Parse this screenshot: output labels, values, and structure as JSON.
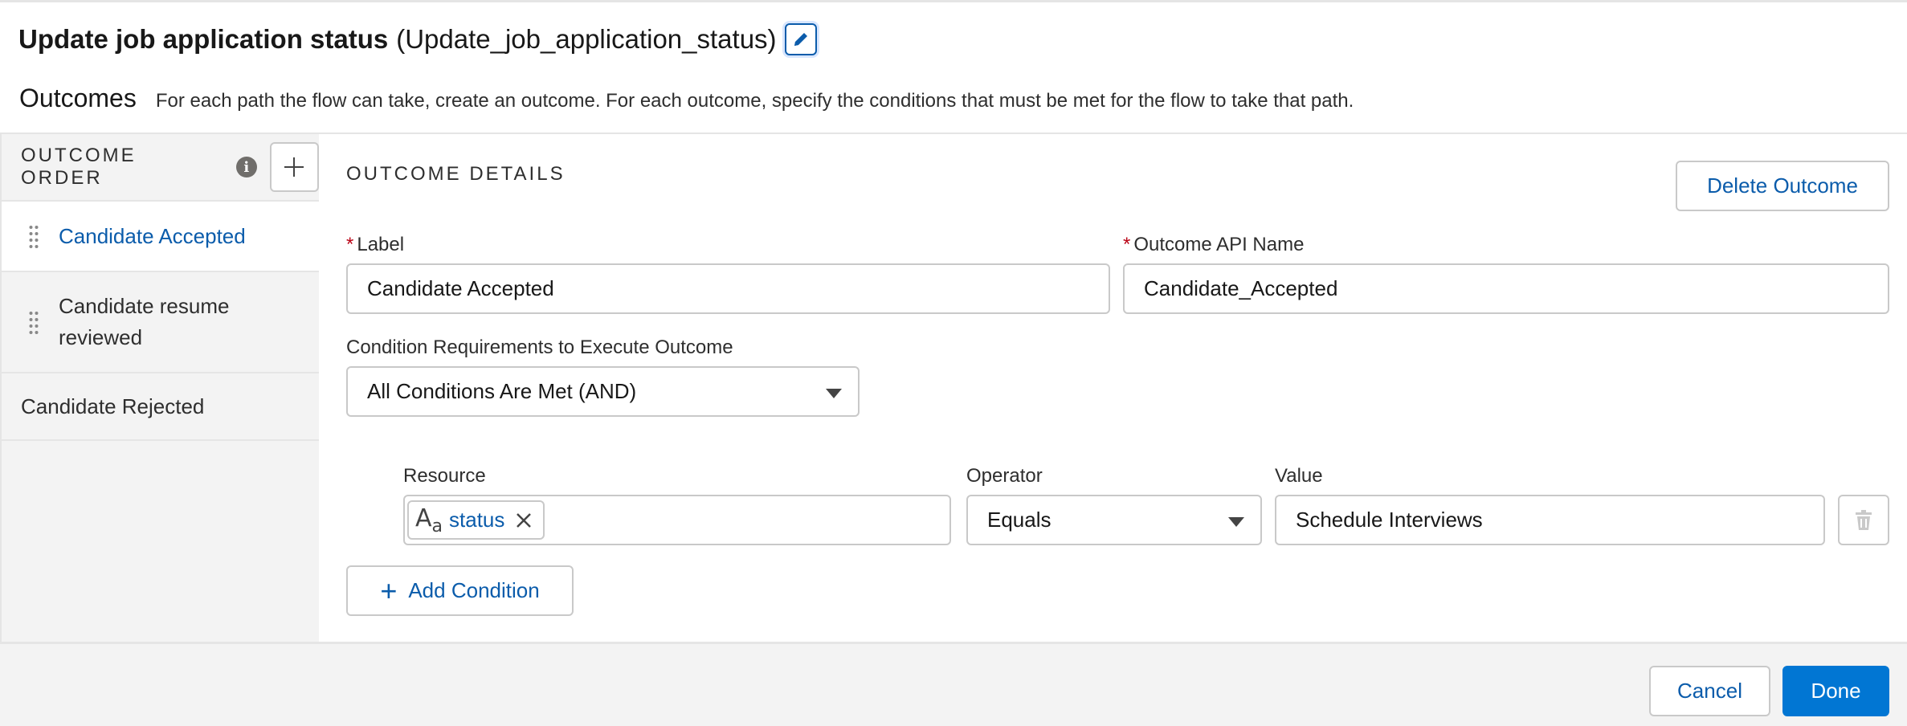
{
  "header": {
    "title": "Update job application status",
    "api_name": "(Update_job_application_status)",
    "edit_icon": "pencil-icon"
  },
  "outcomes_section": {
    "heading": "Outcomes",
    "description": "For each path the flow can take, create an outcome. For each outcome, specify the conditions that must be met for the flow to take that path."
  },
  "sidebar": {
    "header_label": "OUTCOME ORDER",
    "info_icon": "info-icon",
    "info_glyph": "i",
    "add_icon": "plus-icon",
    "items": [
      {
        "label": "Candidate Accepted",
        "active": true
      },
      {
        "label": "Candidate resume reviewed",
        "active": false
      },
      {
        "label": "Candidate Rejected",
        "active": false
      }
    ]
  },
  "details": {
    "heading": "OUTCOME DETAILS",
    "delete_label": "Delete Outcome",
    "required_mark": "*",
    "label_field": {
      "label": "Label",
      "value": "Candidate Accepted"
    },
    "api_field": {
      "label": "Outcome API Name",
      "value": "Candidate_Accepted"
    },
    "condition_req": {
      "label": "Condition Requirements to Execute Outcome",
      "value": "All Conditions Are Met (AND)"
    },
    "condition": {
      "resource_label": "Resource",
      "resource_icon": "text-type-icon",
      "resource_glyph_a": "A",
      "resource_glyph_sub": "a",
      "resource_value": "status",
      "operator_label": "Operator",
      "operator_value": "Equals",
      "value_label": "Value",
      "value_value": "Schedule Interviews"
    },
    "add_condition_label": "Add Condition",
    "add_condition_plus": "+"
  },
  "footer": {
    "cancel_label": "Cancel",
    "done_label": "Done"
  },
  "colors": {
    "brand": "#0176d3",
    "link": "#0b5cab",
    "required": "#ba0517"
  }
}
